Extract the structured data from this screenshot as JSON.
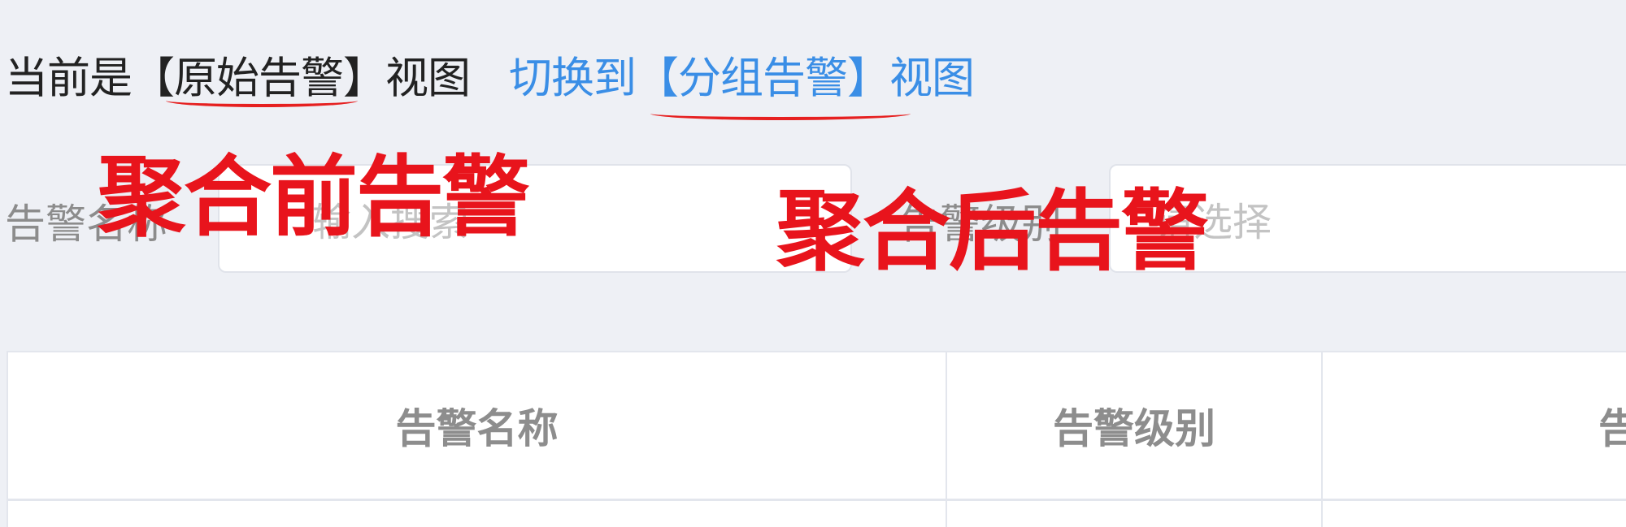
{
  "view_toggle": {
    "current_view_text": "当前是【原始告警】视图",
    "switch_link_text": "切换到【分组告警】视图"
  },
  "filters": {
    "alarm_name_label": "告警名称",
    "alarm_name_placeholder": "输入搜索",
    "alarm_level_label": "告警级别",
    "alarm_level_placeholder": "请选择"
  },
  "annotations": {
    "before": "聚合前告警",
    "after": "聚合后告警",
    "color": "#e8141c"
  },
  "table": {
    "columns": [
      "告警名称",
      "告警级别",
      "告"
    ]
  },
  "colors": {
    "background": "#eef0f5",
    "link": "#3a8ee6"
  }
}
